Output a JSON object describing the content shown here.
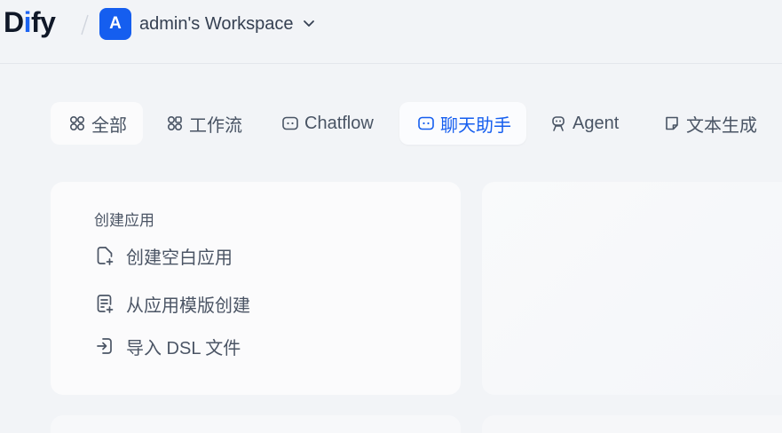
{
  "header": {
    "logo_d": "D",
    "logo_i": "i",
    "logo_fy": "fy",
    "workspace_initial": "A",
    "workspace_name": "admin's Workspace"
  },
  "tabs": [
    {
      "label": "全部",
      "icon": "grid-icon"
    },
    {
      "label": "工作流",
      "icon": "workflow-icon"
    },
    {
      "label": "Chatflow",
      "icon": "chatflow-icon"
    },
    {
      "label": "聊天助手",
      "icon": "chat-assistant-icon",
      "selected": true
    },
    {
      "label": "Agent",
      "icon": "agent-icon"
    },
    {
      "label": "文本生成",
      "icon": "text-generation-icon"
    }
  ],
  "create_card": {
    "title": "创建应用",
    "items": [
      {
        "label": "创建空白应用",
        "icon": "file-plus-icon"
      },
      {
        "label": "从应用模版创建",
        "icon": "template-icon"
      },
      {
        "label": "导入 DSL 文件",
        "icon": "import-icon"
      }
    ]
  },
  "colors": {
    "accent": "#155eef",
    "background": "#f2f4f7",
    "card": "#fbfbfc"
  }
}
